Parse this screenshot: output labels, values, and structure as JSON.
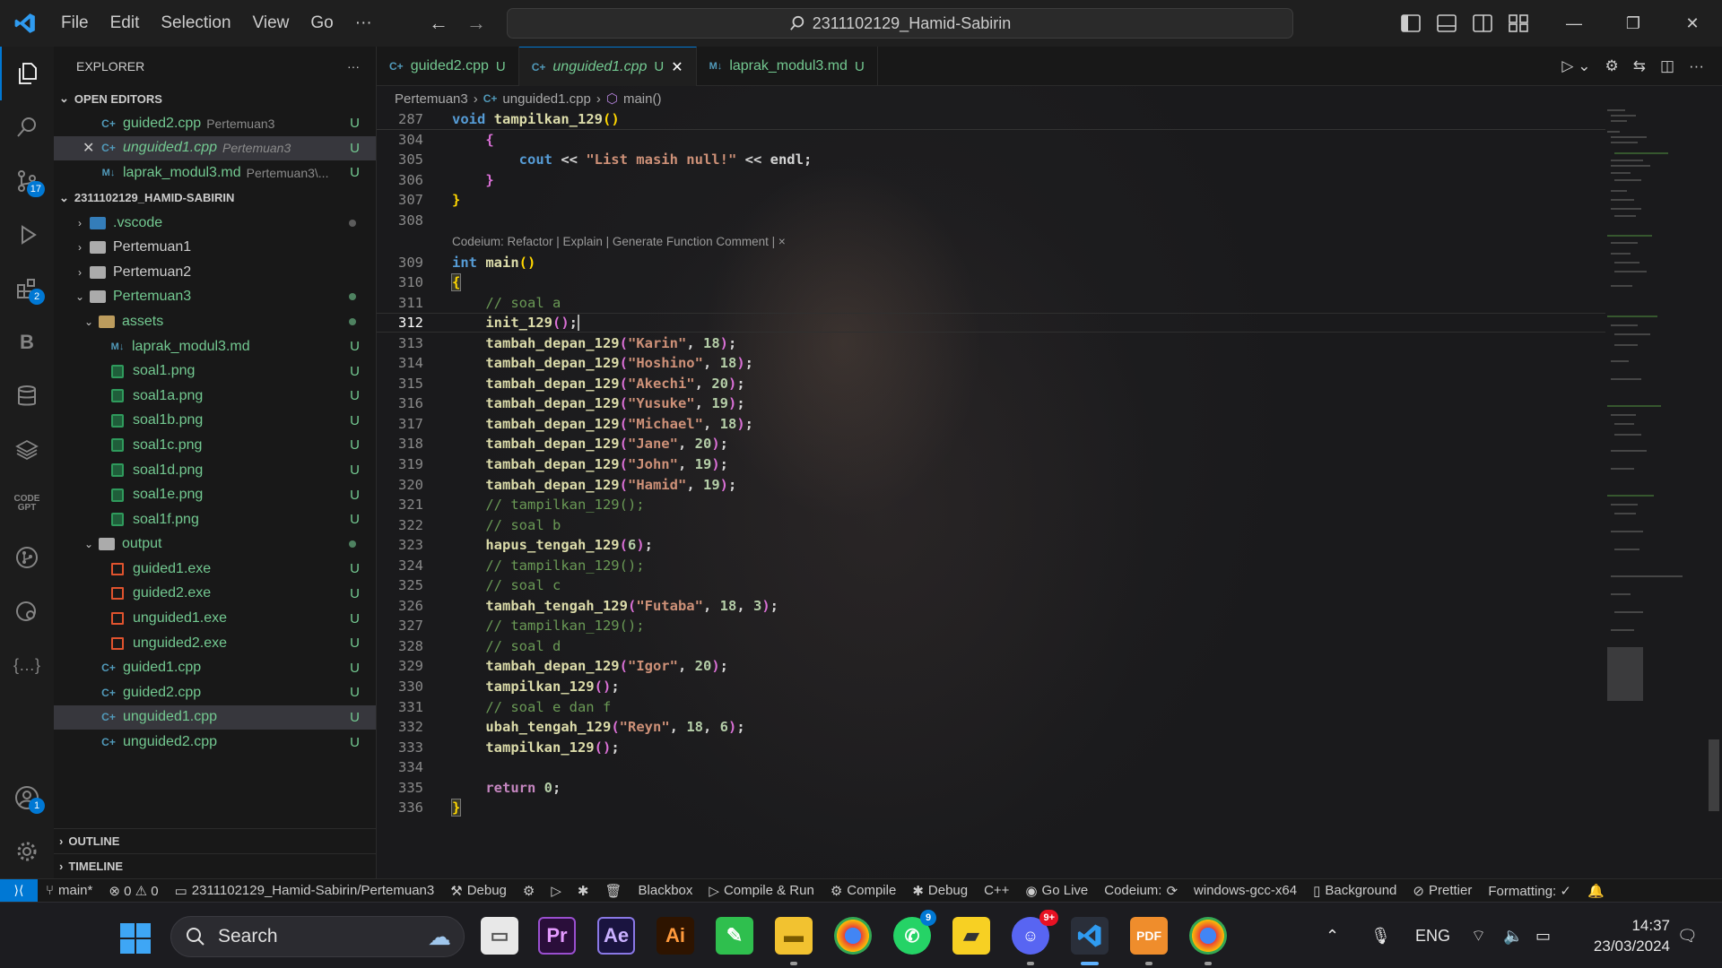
{
  "titlebar": {
    "menu": [
      "File",
      "Edit",
      "Selection",
      "View",
      "Go",
      "···"
    ],
    "search_text": "2311102129_Hamid-Sabirin"
  },
  "activity_badges": {
    "scm": "17",
    "extensions": "2",
    "accounts": "1"
  },
  "sidebar": {
    "title": "EXPLORER",
    "more": "···",
    "open_editors_title": "OPEN EDITORS",
    "open_editors": [
      {
        "name": "guided2.cpp",
        "path": "Pertemuan3",
        "status": "U"
      },
      {
        "name": "unguided1.cpp",
        "path": "Pertemuan3",
        "status": "U"
      },
      {
        "name": "laprak_modul3.md",
        "path": "Pertemuan3\\...",
        "status": "U"
      }
    ],
    "folder_title": "2311102129_HAMID-SABIRIN",
    "tree": [
      {
        "name": ".vscode"
      },
      {
        "name": "Pertemuan1"
      },
      {
        "name": "Pertemuan2"
      },
      {
        "name": "Pertemuan3"
      },
      {
        "name": "assets"
      },
      {
        "name": "laprak_modul3.md",
        "status": "U"
      },
      {
        "name": "soal1.png",
        "status": "U"
      },
      {
        "name": "soal1a.png",
        "status": "U"
      },
      {
        "name": "soal1b.png",
        "status": "U"
      },
      {
        "name": "soal1c.png",
        "status": "U"
      },
      {
        "name": "soal1d.png",
        "status": "U"
      },
      {
        "name": "soal1e.png",
        "status": "U"
      },
      {
        "name": "soal1f.png",
        "status": "U"
      },
      {
        "name": "output"
      },
      {
        "name": "guided1.exe",
        "status": "U"
      },
      {
        "name": "guided2.exe",
        "status": "U"
      },
      {
        "name": "unguided1.exe",
        "status": "U"
      },
      {
        "name": "unguided2.exe",
        "status": "U"
      },
      {
        "name": "guided1.cpp",
        "status": "U"
      },
      {
        "name": "guided2.cpp",
        "status": "U"
      },
      {
        "name": "unguided1.cpp",
        "status": "U"
      },
      {
        "name": "unguided2.cpp",
        "status": "U"
      }
    ],
    "outline": "OUTLINE",
    "timeline": "TIMELINE"
  },
  "tabs": [
    {
      "label": "guided2.cpp",
      "status": "U"
    },
    {
      "label": "unguided1.cpp",
      "status": "U"
    },
    {
      "label": "laprak_modul3.md",
      "status": "U"
    }
  ],
  "breadcrumb": {
    "folder": "Pertemuan3",
    "file": "unguided1.cpp",
    "symbol": "main()"
  },
  "codelens": "Codeium: Refactor | Explain | Generate Function Comment | ×",
  "line_numbers": [
    "287",
    "304",
    "305",
    "306",
    "307",
    "308",
    "309",
    "310",
    "311",
    "312",
    "313",
    "314",
    "315",
    "316",
    "317",
    "318",
    "319",
    "320",
    "321",
    "322",
    "323",
    "324",
    "325",
    "326",
    "327",
    "328",
    "329",
    "330",
    "331",
    "332",
    "333",
    "334",
    "335",
    "336"
  ],
  "code": {
    "l287_kw": "void",
    "l287_fn": "tampilkan_129",
    "l305_a": "cout",
    "l305_op": " << ",
    "l305_str": "\"List masih null!\"",
    "l305_b": " << endl;",
    "l309_kw": "int",
    "l309_fn": "main",
    "c_a": "// soal a",
    "l312": "init_129",
    "calls": [
      {
        "fn": "tambah_depan_129",
        "str": "\"Karin\"",
        "num": "18"
      },
      {
        "fn": "tambah_depan_129",
        "str": "\"Hoshino\"",
        "num": "18"
      },
      {
        "fn": "tambah_depan_129",
        "str": "\"Akechi\"",
        "num": "20"
      },
      {
        "fn": "tambah_depan_129",
        "str": "\"Yusuke\"",
        "num": "19"
      },
      {
        "fn": "tambah_depan_129",
        "str": "\"Michael\"",
        "num": "18"
      },
      {
        "fn": "tambah_depan_129",
        "str": "\"Jane\"",
        "num": "20"
      },
      {
        "fn": "tambah_depan_129",
        "str": "\"John\"",
        "num": "19"
      },
      {
        "fn": "tambah_depan_129",
        "str": "\"Hamid\"",
        "num": "19"
      }
    ],
    "c_tampil": "// tampilkan_129();",
    "c_b": "// soal b",
    "l323_fn": "hapus_tengah_129",
    "l323_num": "6",
    "c_c": "// soal c",
    "l326_fn": "tambah_tengah_129",
    "l326_str": "\"Futaba\"",
    "l326_n1": "18",
    "l326_n2": "3",
    "c_d": "// soal d",
    "l329_fn": "tambah_depan_129",
    "l329_str": "\"Igor\"",
    "l329_num": "20",
    "l330_fn": "tampilkan_129",
    "c_e": "// soal e dan f",
    "l332_fn": "ubah_tengah_129",
    "l332_str": "\"Reyn\"",
    "l332_n1": "18",
    "l332_n2": "6",
    "l333_fn": "tampilkan_129",
    "l335_kw": "return",
    "l335_num": "0"
  },
  "statusbar": {
    "branch": "main*",
    "problems": "⊗ 0 ⚠ 0",
    "path": "2311102129_Hamid-Sabirin/Pertemuan3",
    "debug": "Debug",
    "blackbox": "Blackbox",
    "compile_run": "Compile & Run",
    "compile": "Compile",
    "debug2": "Debug",
    "lang": "C++",
    "golive": "Go Live",
    "codeium": "Codeium:",
    "compiler": "windows-gcc-x64",
    "background": "Background",
    "prettier": "Prettier",
    "formatting": "Formatting: ✓"
  },
  "taskbar": {
    "search": "Search",
    "lang": "ENG",
    "time": "14:37",
    "date": "23/03/2024",
    "whatsapp_badge": "9",
    "discord_badge": "9+"
  },
  "colors": {
    "accent": "#0078d4",
    "untracked": "#73c991"
  }
}
